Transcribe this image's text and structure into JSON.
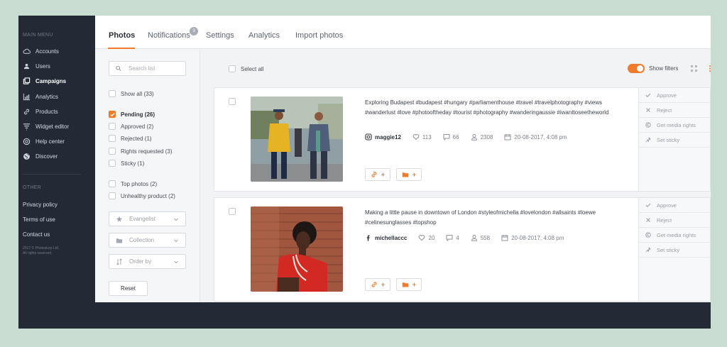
{
  "sidebar": {
    "main_heading": "MAIN MENU",
    "items": [
      {
        "label": "Accounts",
        "icon": "cloud-icon"
      },
      {
        "label": "Users",
        "icon": "users-icon"
      },
      {
        "label": "Campaigns",
        "icon": "campaigns-icon",
        "active": true
      },
      {
        "label": "Analytics",
        "icon": "analytics-icon"
      },
      {
        "label": "Products",
        "icon": "link-icon"
      },
      {
        "label": "Widget editor",
        "icon": "widget-icon"
      },
      {
        "label": "Help center",
        "icon": "help-icon"
      },
      {
        "label": "Discover",
        "icon": "globe-icon"
      }
    ],
    "other_heading": "OTHER",
    "other_items": [
      "Privacy policy",
      "Terms of use",
      "Contact us"
    ],
    "copyright_line1": "2017 © Photoslurp Ltd.",
    "copyright_line2": "All rights reserved."
  },
  "tabs": {
    "photos": "Photos",
    "notifications": "Notifications",
    "notifications_count": "3",
    "settings": "Settings",
    "analytics": "Analytics",
    "import": "Import photos"
  },
  "filters": {
    "search_placeholder": "Search list",
    "show_all": "Show all (33)",
    "pending": "Pending (26)",
    "approved": "Approved (2)",
    "rejected": "Rejected (1)",
    "rights_requested": "Rights requested (3)",
    "sticky": "Sticky (1)",
    "top_photos": "Top photos (2)",
    "unhealthy": "Unhealthy product (2)",
    "evangelist": "Evangelist",
    "collection": "Collection",
    "order_by": "Order by",
    "reset": "Reset"
  },
  "content": {
    "select_all": "Select all",
    "show_filters": "Show filters"
  },
  "posts": [
    {
      "caption": "Exploring Budapest #budapest #hungary #parliamenthouse #travel #travelphotography #views #wanderlust #love #photooftheday #tourist #photography #wanderingaussie #iwanttoseetheworld",
      "network_icon": "instagram-icon",
      "user": "maggie12",
      "likes": "113",
      "comments": "66",
      "views": "2308",
      "date": "20-08-2017, 4:08 pm"
    },
    {
      "caption": "Making a little pause in downtown of London #styleofmichella #lovelondon #allsaints #loewe #celinesunglasses #topshop",
      "network_icon": "facebook-icon",
      "user": "michellaccc",
      "likes": "20",
      "comments": "4",
      "views": "558",
      "date": "20-08-2017, 4:08 pm"
    }
  ],
  "card_actions": {
    "approve": "Approve",
    "reject": "Reject",
    "media_rights": "Get media rights",
    "sticky": "Set sticky"
  },
  "colors": {
    "accent": "#f07b2a",
    "sidebar": "#232a36",
    "background": "#c9dcd2"
  }
}
